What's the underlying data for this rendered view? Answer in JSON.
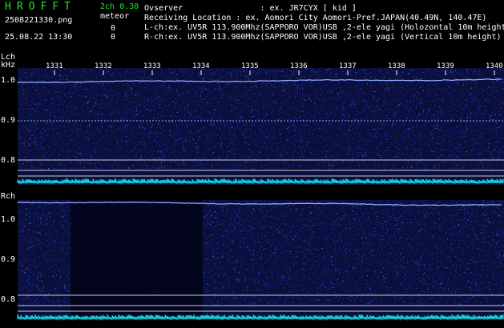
{
  "app": {
    "logo": "HROFFT",
    "version": "2ch 0.30",
    "filename": "2508221330.png",
    "datetime": "25.08.22 13:30",
    "meteor_label": "meteor",
    "meteor_counts": [
      "0",
      "0"
    ],
    "observer": "Ovserver                : ex. JR7CYX [ kid ]",
    "location": "Receiving Location : ex. Aomori City Aomori-Pref.JAPAN(40.49N, 140.47E)",
    "lch_info": "L-ch:ex. UV5R 113.900Mhz(SAPPORO VOR)USB ,2-ele yagi (Holozontal 10m height)",
    "rch_info": "R-ch:ex. UV5R 113.900Mhz(SAPPORO VOR)USB ,2-ele yagi (Vertical 10m height)"
  },
  "time_axis": {
    "labels": [
      "1331",
      "1332",
      "1333",
      "1334",
      "1335",
      "1336",
      "1337",
      "1338",
      "1339",
      "1340"
    ]
  },
  "lch_panel": {
    "title": "Lch",
    "unit": "kHz",
    "freq_ticks": [
      "1.0",
      "0.9",
      "0.8"
    ]
  },
  "rch_panel": {
    "title": "Rch",
    "freq_ticks": [
      "1.0",
      "0.9",
      "0.8"
    ],
    "dropout_minutes": [
      "1332",
      "1333",
      "1334"
    ]
  },
  "colors": {
    "background": "#000000",
    "noise": "#1a2a9e",
    "trace": "#8fa6ff",
    "cyan_level": "#19e6e6",
    "gridline": "#c8c8d8",
    "logo_green": "#1ee81e"
  }
}
